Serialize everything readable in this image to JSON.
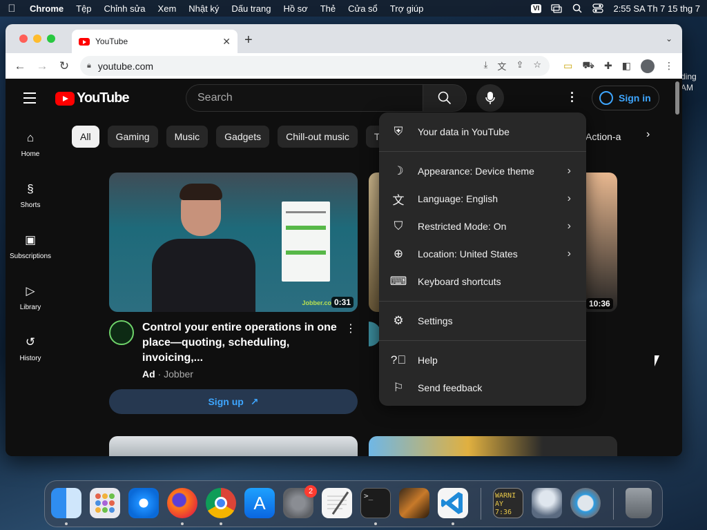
{
  "menubar": {
    "app": "Chrome",
    "items": [
      "Tệp",
      "Chỉnh sửa",
      "Xem",
      "Nhật ký",
      "Dấu trang",
      "Hồ sơ",
      "Thẻ",
      "Cửa sổ",
      "Trợ giúp"
    ],
    "input_source": "VI",
    "clock": "2:55 SA Th 7 15 thg 7"
  },
  "desktop": {
    "partial_text_1": "ding",
    "partial_text_2": "AM"
  },
  "browser": {
    "tab_title": "YouTube",
    "url": "youtube.com"
  },
  "youtube": {
    "logo_text": "YouTube",
    "search_placeholder": "Search",
    "sign_in": "Sign in",
    "sidebar": [
      {
        "label": "Home",
        "icon": "home-icon"
      },
      {
        "label": "Shorts",
        "icon": "shorts-icon"
      },
      {
        "label": "Subscriptions",
        "icon": "subscriptions-icon"
      },
      {
        "label": "Library",
        "icon": "library-icon"
      },
      {
        "label": "History",
        "icon": "history-icon"
      }
    ],
    "chips": [
      "All",
      "Gaming",
      "Music",
      "Gadgets",
      "Chill-out music",
      "T"
    ],
    "chip_right": "Action-a",
    "video": {
      "title": "Control your entire operations in one place—quoting, scheduling, invoicing,...",
      "ad_label": "Ad",
      "channel": "Jobber",
      "duration": "0:31",
      "brand_tag": "Jobber.co",
      "cta": "Sign up"
    },
    "video3_duration": "10:36",
    "settings_menu": {
      "your_data": "Your data in YouTube",
      "appearance": "Appearance: Device theme",
      "language": "Language: English",
      "restricted": "Restricted Mode: On",
      "location": "Location: United States",
      "keyboard": "Keyboard shortcuts",
      "settings": "Settings",
      "help": "Help",
      "feedback": "Send feedback"
    }
  },
  "dock": {
    "system_settings_badge": "2",
    "console_text_1": "WARNI",
    "console_text_2": "AY 7:36"
  },
  "colors": {
    "youtube_red": "#ff0000",
    "link_blue": "#3ea6ff",
    "menu_bg": "#282828"
  }
}
